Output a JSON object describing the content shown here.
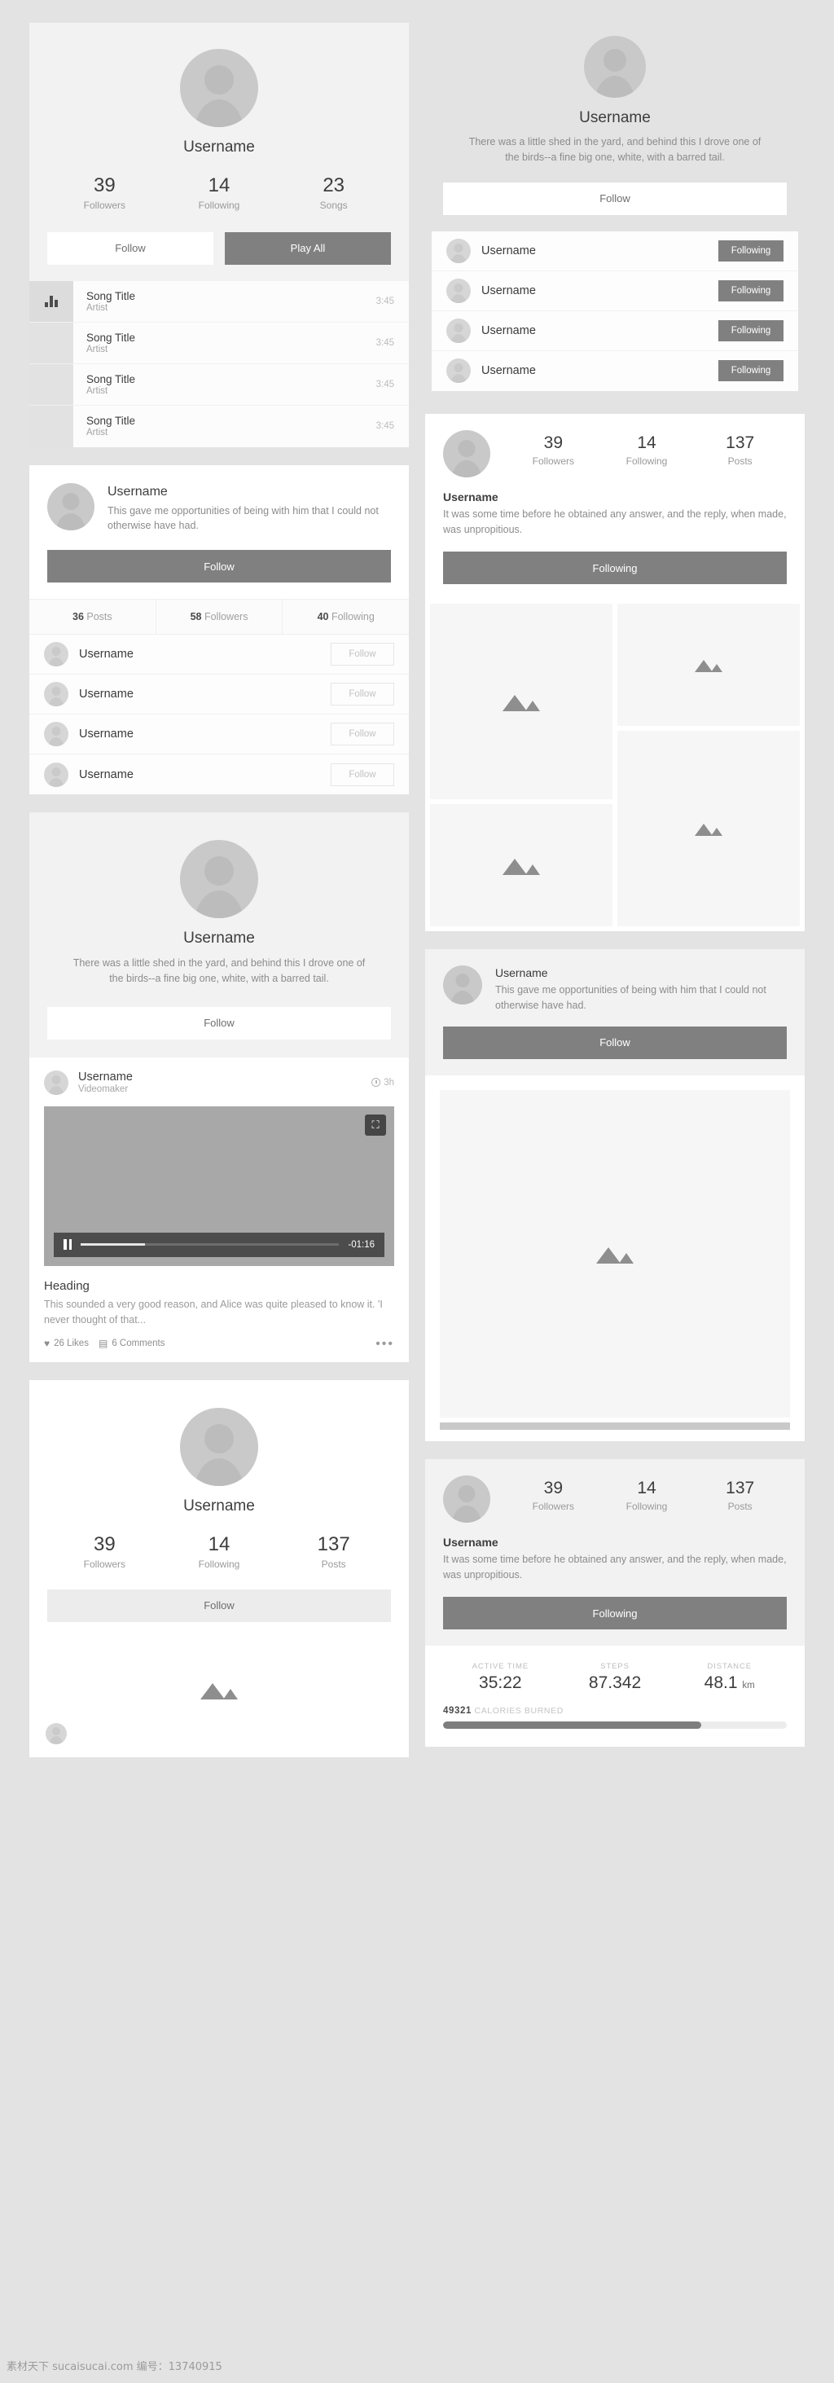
{
  "music_card": {
    "username": "Username",
    "stats": [
      {
        "n": "39",
        "l": "Followers"
      },
      {
        "n": "14",
        "l": "Following"
      },
      {
        "n": "23",
        "l": "Songs"
      }
    ],
    "follow_label": "Follow",
    "play_all_label": "Play All",
    "songs": [
      {
        "title": "Song Title",
        "artist": "Artist",
        "duration": "3:45"
      },
      {
        "title": "Song Title",
        "artist": "Artist",
        "duration": "3:45"
      },
      {
        "title": "Song Title",
        "artist": "Artist",
        "duration": "3:45"
      },
      {
        "title": "Song Title",
        "artist": "Artist",
        "duration": "3:45"
      }
    ]
  },
  "profile_follow_card": {
    "username": "Username",
    "bio": "This gave me opportunities of being with him that I could not otherwise have had.",
    "follow_label": "Follow",
    "tabs": [
      {
        "count": "36",
        "label": "Posts"
      },
      {
        "count": "58",
        "label": "Followers"
      },
      {
        "count": "40",
        "label": "Following"
      }
    ],
    "people": [
      {
        "name": "Username",
        "action": "Follow"
      },
      {
        "name": "Username",
        "action": "Follow"
      },
      {
        "name": "Username",
        "action": "Follow"
      },
      {
        "name": "Username",
        "action": "Follow"
      }
    ]
  },
  "bio_card": {
    "username": "Username",
    "bio": "There was a little shed in the yard, and behind this I drove one of the birds--a fine big one, white, with a barred tail.",
    "follow_label": "Follow"
  },
  "video_card": {
    "username": "Username",
    "role": "Videomaker",
    "time": "3h",
    "remaining": "-01:16",
    "heading": "Heading",
    "body": "This sounded a very good reason, and Alice was quite pleased to know it. 'I never thought of that...",
    "likes": "26 Likes",
    "comments": "6 Comments",
    "more_label": "•••",
    "progress_percent": 25
  },
  "profile_posts_card": {
    "username": "Username",
    "stats": [
      {
        "n": "39",
        "l": "Followers"
      },
      {
        "n": "14",
        "l": "Following"
      },
      {
        "n": "137",
        "l": "Posts"
      }
    ],
    "follow_label": "Follow"
  },
  "right_bio_card": {
    "username": "Username",
    "bio": "There was a little shed in the yard, and behind this I drove one of the birds--a fine big one, white, with a barred tail.",
    "follow_label": "Follow",
    "people": [
      {
        "name": "Username",
        "action": "Following"
      },
      {
        "name": "Username",
        "action": "Following"
      },
      {
        "name": "Username",
        "action": "Following"
      },
      {
        "name": "Username",
        "action": "Following"
      }
    ]
  },
  "gallery_card": {
    "username": "Username",
    "bio": "It was some time before he obtained any answer, and the reply, when made, was unpropitious.",
    "following_label": "Following",
    "stats": [
      {
        "n": "39",
        "l": "Followers"
      },
      {
        "n": "14",
        "l": "Following"
      },
      {
        "n": "137",
        "l": "Posts"
      }
    ],
    "photo_count": 4
  },
  "photo_post_card": {
    "username": "Username",
    "bio": "This gave me opportunities of being with him that I could not otherwise have had.",
    "follow_label": "Follow"
  },
  "fitness_card": {
    "username": "Username",
    "bio": "It was some time before he obtained any answer, and the reply, when made, was unpropitious.",
    "following_label": "Following",
    "stats": [
      {
        "n": "39",
        "l": "Followers"
      },
      {
        "n": "14",
        "l": "Following"
      },
      {
        "n": "137",
        "l": "Posts"
      }
    ],
    "metrics": [
      {
        "key": "ACTIVE TIME",
        "value": "35:22",
        "unit": ""
      },
      {
        "key": "STEPS",
        "value": "87.342",
        "unit": ""
      },
      {
        "key": "DISTANCE",
        "value": "48.1",
        "unit": "km"
      }
    ],
    "calories_value": "49321",
    "calories_label": "CALORIES BURNED",
    "calories_percent": 75
  },
  "watermark": "素材天下 sucaisucai.com  编号：13740915",
  "colors": {
    "page_bg": "#e3e3e3",
    "card_bg": "#ffffff",
    "accent_dark": "#808080",
    "muted": "#9a9a9a"
  }
}
